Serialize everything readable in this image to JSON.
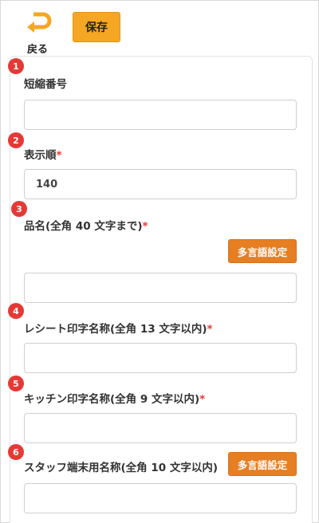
{
  "header": {
    "back_label": "戻る",
    "back_icon": "back-arrow-icon",
    "save_label": "保存",
    "accent_color": "#f5a623"
  },
  "form": {
    "required_mark": "*",
    "multilang_label": "多言語設定",
    "fields": [
      {
        "number": "1",
        "label": "短縮番号",
        "required": false,
        "value": ""
      },
      {
        "number": "2",
        "label": "表示順",
        "required": true,
        "value": "140"
      },
      {
        "number": "3",
        "label": "品名(全角 40 文字まで)",
        "required": true,
        "value": ""
      },
      {
        "number": "4",
        "label": "レシート印字名称(全角 13 文字以内)",
        "required": true,
        "value": ""
      },
      {
        "number": "5",
        "label": "キッチン印字名称(全角 9 文字以内)",
        "required": true,
        "value": ""
      },
      {
        "number": "6",
        "label": "スタッフ端末用名称(全角 10 文字以内)",
        "required": false,
        "value": ""
      }
    ]
  }
}
